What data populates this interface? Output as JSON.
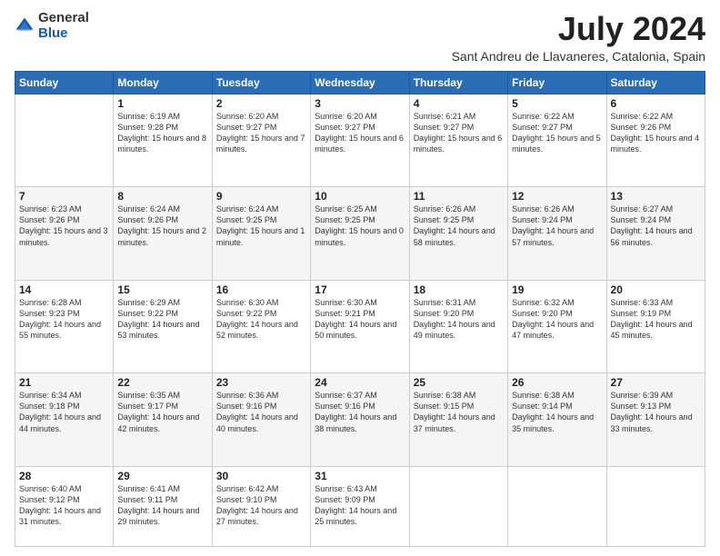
{
  "logo": {
    "general": "General",
    "blue": "Blue"
  },
  "header": {
    "title": "July 2024",
    "subtitle": "Sant Andreu de Llavaneres, Catalonia, Spain"
  },
  "weekdays": [
    "Sunday",
    "Monday",
    "Tuesday",
    "Wednesday",
    "Thursday",
    "Friday",
    "Saturday"
  ],
  "weeks": [
    [
      {
        "day": "",
        "sunrise": "",
        "sunset": "",
        "daylight": ""
      },
      {
        "day": "1",
        "sunrise": "Sunrise: 6:19 AM",
        "sunset": "Sunset: 9:28 PM",
        "daylight": "Daylight: 15 hours and 8 minutes."
      },
      {
        "day": "2",
        "sunrise": "Sunrise: 6:20 AM",
        "sunset": "Sunset: 9:27 PM",
        "daylight": "Daylight: 15 hours and 7 minutes."
      },
      {
        "day": "3",
        "sunrise": "Sunrise: 6:20 AM",
        "sunset": "Sunset: 9:27 PM",
        "daylight": "Daylight: 15 hours and 6 minutes."
      },
      {
        "day": "4",
        "sunrise": "Sunrise: 6:21 AM",
        "sunset": "Sunset: 9:27 PM",
        "daylight": "Daylight: 15 hours and 6 minutes."
      },
      {
        "day": "5",
        "sunrise": "Sunrise: 6:22 AM",
        "sunset": "Sunset: 9:27 PM",
        "daylight": "Daylight: 15 hours and 5 minutes."
      },
      {
        "day": "6",
        "sunrise": "Sunrise: 6:22 AM",
        "sunset": "Sunset: 9:26 PM",
        "daylight": "Daylight: 15 hours and 4 minutes."
      }
    ],
    [
      {
        "day": "7",
        "sunrise": "Sunrise: 6:23 AM",
        "sunset": "Sunset: 9:26 PM",
        "daylight": "Daylight: 15 hours and 3 minutes."
      },
      {
        "day": "8",
        "sunrise": "Sunrise: 6:24 AM",
        "sunset": "Sunset: 9:26 PM",
        "daylight": "Daylight: 15 hours and 2 minutes."
      },
      {
        "day": "9",
        "sunrise": "Sunrise: 6:24 AM",
        "sunset": "Sunset: 9:25 PM",
        "daylight": "Daylight: 15 hours and 1 minute."
      },
      {
        "day": "10",
        "sunrise": "Sunrise: 6:25 AM",
        "sunset": "Sunset: 9:25 PM",
        "daylight": "Daylight: 15 hours and 0 minutes."
      },
      {
        "day": "11",
        "sunrise": "Sunrise: 6:26 AM",
        "sunset": "Sunset: 9:25 PM",
        "daylight": "Daylight: 14 hours and 58 minutes."
      },
      {
        "day": "12",
        "sunrise": "Sunrise: 6:26 AM",
        "sunset": "Sunset: 9:24 PM",
        "daylight": "Daylight: 14 hours and 57 minutes."
      },
      {
        "day": "13",
        "sunrise": "Sunrise: 6:27 AM",
        "sunset": "Sunset: 9:24 PM",
        "daylight": "Daylight: 14 hours and 56 minutes."
      }
    ],
    [
      {
        "day": "14",
        "sunrise": "Sunrise: 6:28 AM",
        "sunset": "Sunset: 9:23 PM",
        "daylight": "Daylight: 14 hours and 55 minutes."
      },
      {
        "day": "15",
        "sunrise": "Sunrise: 6:29 AM",
        "sunset": "Sunset: 9:22 PM",
        "daylight": "Daylight: 14 hours and 53 minutes."
      },
      {
        "day": "16",
        "sunrise": "Sunrise: 6:30 AM",
        "sunset": "Sunset: 9:22 PM",
        "daylight": "Daylight: 14 hours and 52 minutes."
      },
      {
        "day": "17",
        "sunrise": "Sunrise: 6:30 AM",
        "sunset": "Sunset: 9:21 PM",
        "daylight": "Daylight: 14 hours and 50 minutes."
      },
      {
        "day": "18",
        "sunrise": "Sunrise: 6:31 AM",
        "sunset": "Sunset: 9:20 PM",
        "daylight": "Daylight: 14 hours and 49 minutes."
      },
      {
        "day": "19",
        "sunrise": "Sunrise: 6:32 AM",
        "sunset": "Sunset: 9:20 PM",
        "daylight": "Daylight: 14 hours and 47 minutes."
      },
      {
        "day": "20",
        "sunrise": "Sunrise: 6:33 AM",
        "sunset": "Sunset: 9:19 PM",
        "daylight": "Daylight: 14 hours and 45 minutes."
      }
    ],
    [
      {
        "day": "21",
        "sunrise": "Sunrise: 6:34 AM",
        "sunset": "Sunset: 9:18 PM",
        "daylight": "Daylight: 14 hours and 44 minutes."
      },
      {
        "day": "22",
        "sunrise": "Sunrise: 6:35 AM",
        "sunset": "Sunset: 9:17 PM",
        "daylight": "Daylight: 14 hours and 42 minutes."
      },
      {
        "day": "23",
        "sunrise": "Sunrise: 6:36 AM",
        "sunset": "Sunset: 9:16 PM",
        "daylight": "Daylight: 14 hours and 40 minutes."
      },
      {
        "day": "24",
        "sunrise": "Sunrise: 6:37 AM",
        "sunset": "Sunset: 9:16 PM",
        "daylight": "Daylight: 14 hours and 38 minutes."
      },
      {
        "day": "25",
        "sunrise": "Sunrise: 6:38 AM",
        "sunset": "Sunset: 9:15 PM",
        "daylight": "Daylight: 14 hours and 37 minutes."
      },
      {
        "day": "26",
        "sunrise": "Sunrise: 6:38 AM",
        "sunset": "Sunset: 9:14 PM",
        "daylight": "Daylight: 14 hours and 35 minutes."
      },
      {
        "day": "27",
        "sunrise": "Sunrise: 6:39 AM",
        "sunset": "Sunset: 9:13 PM",
        "daylight": "Daylight: 14 hours and 33 minutes."
      }
    ],
    [
      {
        "day": "28",
        "sunrise": "Sunrise: 6:40 AM",
        "sunset": "Sunset: 9:12 PM",
        "daylight": "Daylight: 14 hours and 31 minutes."
      },
      {
        "day": "29",
        "sunrise": "Sunrise: 6:41 AM",
        "sunset": "Sunset: 9:11 PM",
        "daylight": "Daylight: 14 hours and 29 minutes."
      },
      {
        "day": "30",
        "sunrise": "Sunrise: 6:42 AM",
        "sunset": "Sunset: 9:10 PM",
        "daylight": "Daylight: 14 hours and 27 minutes."
      },
      {
        "day": "31",
        "sunrise": "Sunrise: 6:43 AM",
        "sunset": "Sunset: 9:09 PM",
        "daylight": "Daylight: 14 hours and 25 minutes."
      },
      {
        "day": "",
        "sunrise": "",
        "sunset": "",
        "daylight": ""
      },
      {
        "day": "",
        "sunrise": "",
        "sunset": "",
        "daylight": ""
      },
      {
        "day": "",
        "sunrise": "",
        "sunset": "",
        "daylight": ""
      }
    ]
  ]
}
